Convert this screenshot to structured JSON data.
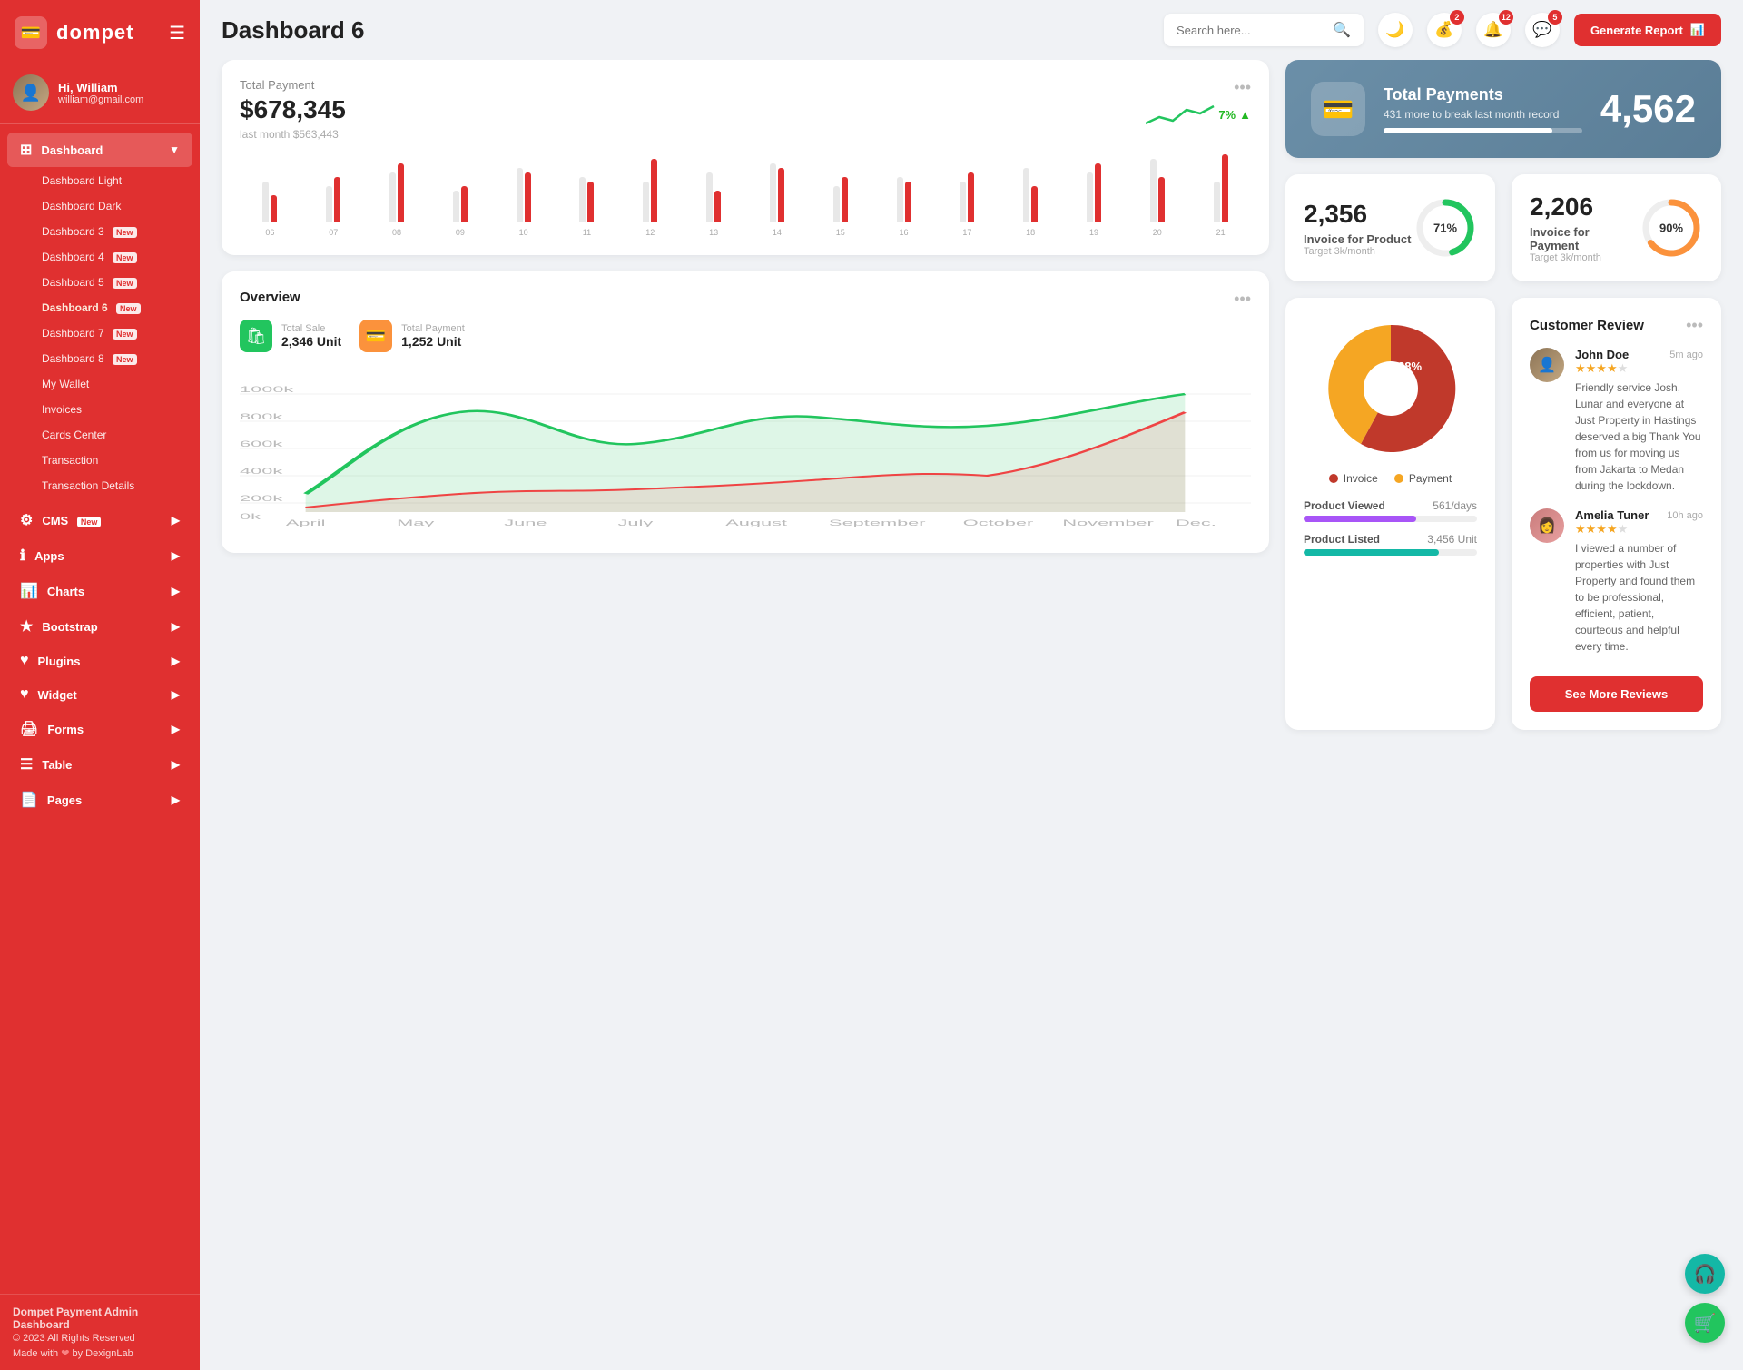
{
  "app": {
    "logo_text": "dompet",
    "logo_icon": "💳"
  },
  "user": {
    "greeting": "Hi, William",
    "email": "william@gmail.com"
  },
  "header": {
    "title": "Dashboard 6",
    "search_placeholder": "Search here...",
    "generate_label": "Generate Report"
  },
  "badges": {
    "wallet": "2",
    "bell": "12",
    "chat": "5"
  },
  "sidebar": {
    "dashboard_label": "Dashboard",
    "items": [
      {
        "label": "Dashboard Light"
      },
      {
        "label": "Dashboard Dark"
      },
      {
        "label": "Dashboard 3",
        "badge": "New"
      },
      {
        "label": "Dashboard 4",
        "badge": "New"
      },
      {
        "label": "Dashboard 5",
        "badge": "New"
      },
      {
        "label": "Dashboard 6",
        "badge": "New",
        "active": true
      },
      {
        "label": "Dashboard 7",
        "badge": "New"
      },
      {
        "label": "Dashboard 8",
        "badge": "New"
      },
      {
        "label": "My Wallet"
      },
      {
        "label": "Invoices"
      },
      {
        "label": "Cards Center"
      },
      {
        "label": "Transaction"
      },
      {
        "label": "Transaction Details"
      }
    ],
    "nav": [
      {
        "label": "CMS",
        "badge": "New",
        "arrow": true
      },
      {
        "label": "Apps",
        "arrow": true
      },
      {
        "label": "Charts",
        "arrow": true
      },
      {
        "label": "Bootstrap",
        "arrow": true
      },
      {
        "label": "Plugins",
        "arrow": true
      },
      {
        "label": "Widget",
        "arrow": true
      },
      {
        "label": "Forms",
        "arrow": true
      },
      {
        "label": "Table",
        "arrow": true
      },
      {
        "label": "Pages",
        "arrow": true
      }
    ],
    "footer_title": "Dompet Payment Admin Dashboard",
    "footer_copy": "© 2023 All Rights Reserved",
    "footer_made": "Made with ❤ by DexignLab"
  },
  "total_payment": {
    "label": "Total Payment",
    "amount": "$678,345",
    "last_month": "last month $563,443",
    "trend": "7%",
    "trend_dir": "up",
    "bars": [
      {
        "gray": 45,
        "red": 30
      },
      {
        "gray": 40,
        "red": 50
      },
      {
        "gray": 55,
        "red": 65
      },
      {
        "gray": 35,
        "red": 40
      },
      {
        "gray": 60,
        "red": 55
      },
      {
        "gray": 50,
        "red": 45
      },
      {
        "gray": 45,
        "red": 70
      },
      {
        "gray": 55,
        "red": 35
      },
      {
        "gray": 65,
        "red": 60
      },
      {
        "gray": 40,
        "red": 50
      },
      {
        "gray": 50,
        "red": 45
      },
      {
        "gray": 45,
        "red": 55
      },
      {
        "gray": 60,
        "red": 40
      },
      {
        "gray": 55,
        "red": 65
      },
      {
        "gray": 70,
        "red": 50
      },
      {
        "gray": 45,
        "red": 75
      }
    ],
    "x_labels": [
      "06",
      "07",
      "08",
      "09",
      "10",
      "11",
      "12",
      "13",
      "14",
      "15",
      "16",
      "17",
      "18",
      "19",
      "20",
      "21"
    ]
  },
  "total_payments_blue": {
    "title": "Total Payments",
    "sub": "431 more to break last month record",
    "number": "4,562",
    "progress": 85
  },
  "invoice_product": {
    "number": "2,356",
    "label": "Invoice for Product",
    "target": "Target 3k/month",
    "percent": 71,
    "color": "#22c55e"
  },
  "invoice_payment": {
    "number": "2,206",
    "label": "Invoice for Payment",
    "target": "Target 3k/month",
    "percent": 90,
    "color": "#fb923c"
  },
  "overview": {
    "title": "Overview",
    "total_sale_label": "Total Sale",
    "total_sale_val": "2,346 Unit",
    "total_payment_label": "Total Payment",
    "total_payment_val": "1,252 Unit",
    "months": [
      "April",
      "May",
      "June",
      "July",
      "August",
      "September",
      "October",
      "November",
      "Dec."
    ],
    "y_labels": [
      "1000k",
      "800k",
      "600k",
      "400k",
      "200k",
      "0k"
    ]
  },
  "pie_chart": {
    "invoice_pct": 62,
    "payment_pct": 38,
    "invoice_color": "#c0392b",
    "payment_color": "#f5a623",
    "legend_invoice": "Invoice",
    "legend_payment": "Payment"
  },
  "product_stats": [
    {
      "name": "Product Viewed",
      "value": "561/days",
      "percent": 65,
      "color": "#a855f7"
    },
    {
      "name": "Product Listed",
      "value": "3,456 Unit",
      "percent": 78,
      "color": "#14b8a6"
    }
  ],
  "reviews": {
    "title": "Customer Review",
    "see_more_label": "See More Reviews",
    "items": [
      {
        "name": "John Doe",
        "time": "5m ago",
        "stars": 4,
        "text": "Friendly service Josh, Lunar and everyone at Just Property in Hastings deserved a big Thank You from us for moving us from Jakarta to Medan during the lockdown."
      },
      {
        "name": "Amelia Tuner",
        "time": "10h ago",
        "stars": 4,
        "text": "I viewed a number of properties with Just Property and found them to be professional, efficient, patient, courteous and helpful every time."
      }
    ]
  },
  "floating": [
    {
      "icon": "🎧",
      "color": "#14b8a6"
    },
    {
      "icon": "🛒",
      "color": "#22c55e"
    }
  ]
}
